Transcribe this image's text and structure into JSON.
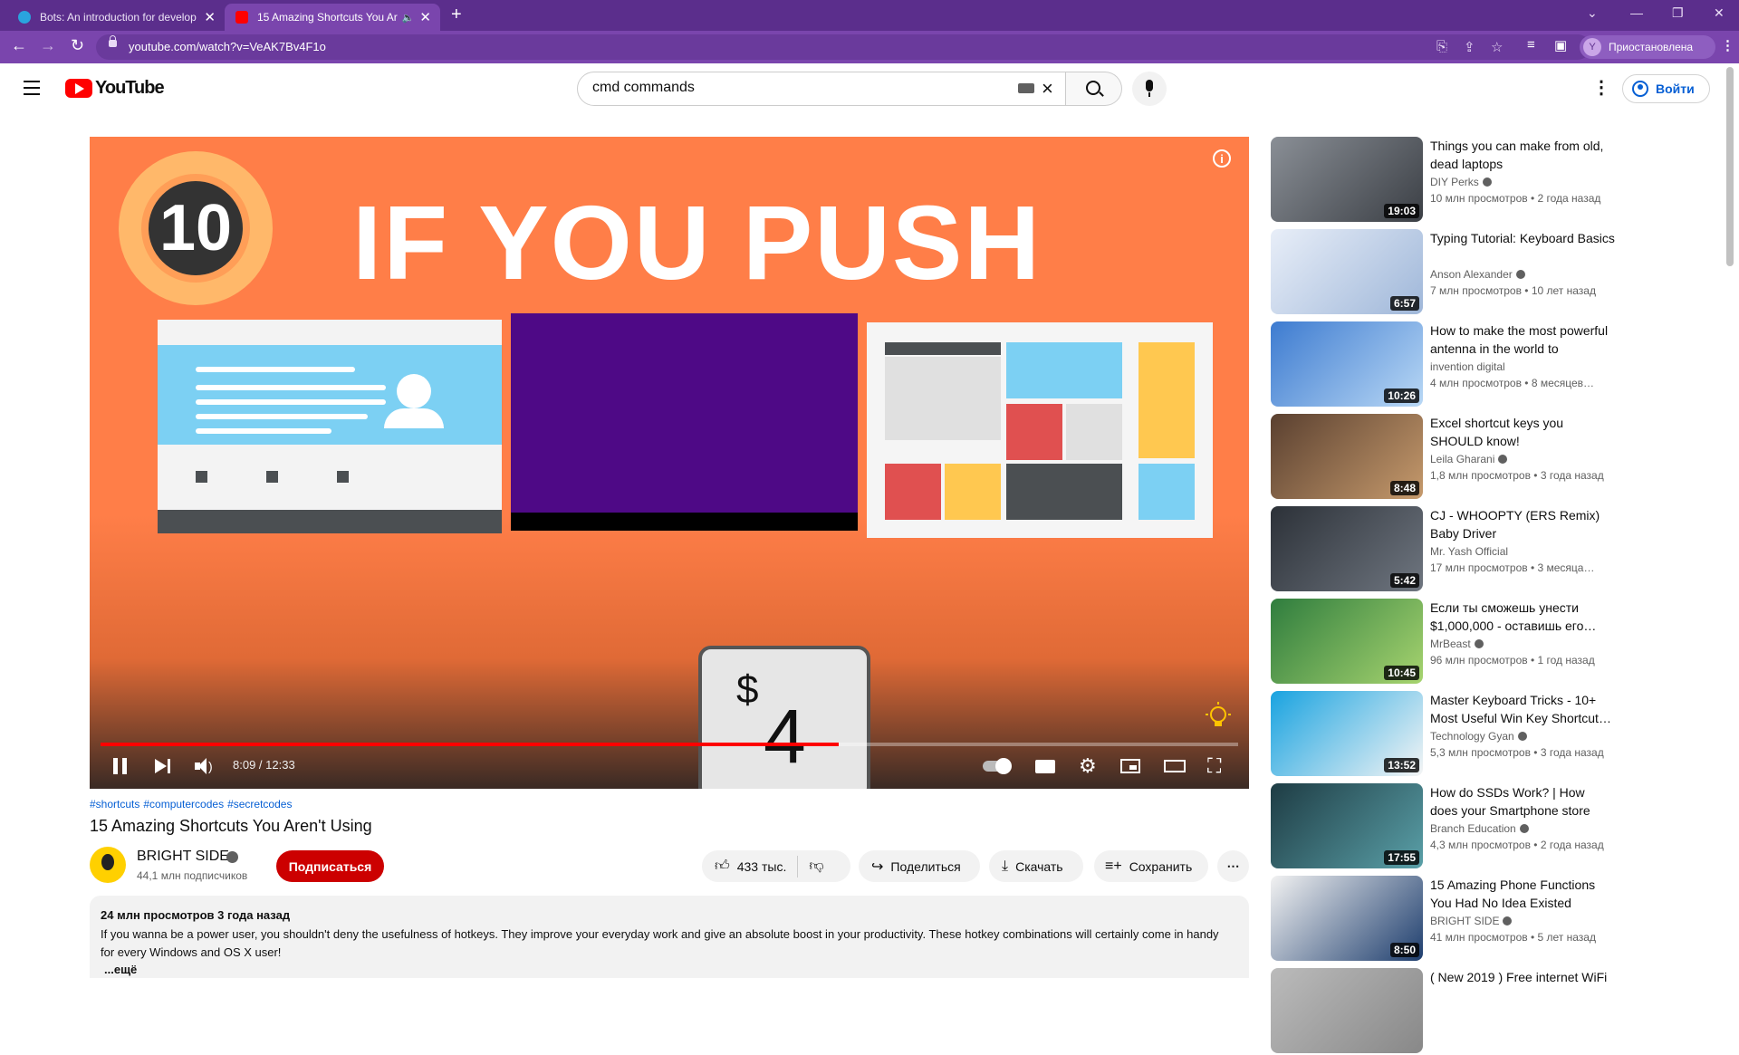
{
  "browser": {
    "tabs": [
      {
        "title": "Bots: An introduction for develop",
        "active": false
      },
      {
        "title": "15 Amazing Shortcuts You Ar",
        "active": true
      }
    ],
    "url": "youtube.com/watch?v=VeAK7Bv4F1o",
    "profile_initial": "Y",
    "profile_label": "Приостановлена",
    "accent_color": "#7a45ad"
  },
  "header": {
    "logo_text": "YouTube",
    "search_value": "cmd commands",
    "signin_label": "Войти"
  },
  "player": {
    "badge_number": "10",
    "headline": "IF YOU PUSH",
    "key_symbol": "$",
    "key_digit": "4",
    "time": "8:09 / 12:33",
    "progress": 0.649,
    "buffered": 0.65
  },
  "video": {
    "tags": [
      "#shortcuts",
      "#computercodes",
      "#secretcodes"
    ],
    "title": "15 Amazing Shortcuts You Aren't Using",
    "channel": "BRIGHT SIDE",
    "subscribers": "44,1 млн подписчиков",
    "subscribe_label": "Подписаться",
    "likes": "433 тыс.",
    "share_label": "Поделиться",
    "download_label": "Скачать",
    "save_label": "Сохранить",
    "description_meta": "24 млн просмотров  3 года назад",
    "description": "If you wanna be a power user, you shouldn't deny the usefulness of hotkeys. They improve your everyday work and give an absolute boost in your productivity. These hotkey combinations will certainly come in handy for every Windows and OS X user!",
    "more_label": "...ещё"
  },
  "recommendations": [
    {
      "title": "Things you can make from old, dead laptops",
      "channel": "DIY Perks",
      "verified": true,
      "meta": "10 млн просмотров • 2 года назад",
      "duration": "19:03"
    },
    {
      "title": "Typing Tutorial: Keyboard Basics",
      "channel": "Anson Alexander",
      "verified": true,
      "meta": "7 млн просмотров • 10 лет назад",
      "duration": "6:57"
    },
    {
      "title": "How to make the most powerful antenna in the world to receive…",
      "channel": "invention digital",
      "verified": false,
      "meta": "4 млн просмотров • 8 месяцев…",
      "duration": "10:26"
    },
    {
      "title": "Excel shortcut keys you SHOULD know!",
      "channel": "Leila Gharani",
      "verified": true,
      "meta": "1,8 млн просмотров • 3 года назад",
      "duration": "8:48"
    },
    {
      "title": "CJ - WHOOPTY (ERS Remix) Baby Driver",
      "channel": "Mr. Yash Official",
      "verified": false,
      "meta": "17 млн просмотров • 3 месяца…",
      "duration": "5:42"
    },
    {
      "title": "Если ты сможешь унести $1,000,000 - оставишь его…",
      "channel": "MrBeast",
      "verified": true,
      "meta": "96 млн просмотров • 1 год назад",
      "duration": "10:45"
    },
    {
      "title": "Master Keyboard Tricks - 10+ Most Useful Win Key Shortcut…",
      "channel": "Technology Gyan",
      "verified": true,
      "meta": "5,3 млн просмотров • 3 года назад",
      "duration": "13:52"
    },
    {
      "title": "How do SSDs Work? | How does your Smartphone store data? |…",
      "channel": "Branch Education",
      "verified": true,
      "meta": "4,3 млн просмотров • 2 года назад",
      "duration": "17:55"
    },
    {
      "title": "15 Amazing Phone Functions You Had No Idea Existed",
      "channel": "BRIGHT SIDE",
      "verified": true,
      "meta": "41 млн просмотров • 5 лет назад",
      "duration": "8:50"
    },
    {
      "title": "( New 2019 ) Free internet WiFi",
      "channel": "",
      "verified": false,
      "meta": "",
      "duration": ""
    }
  ]
}
